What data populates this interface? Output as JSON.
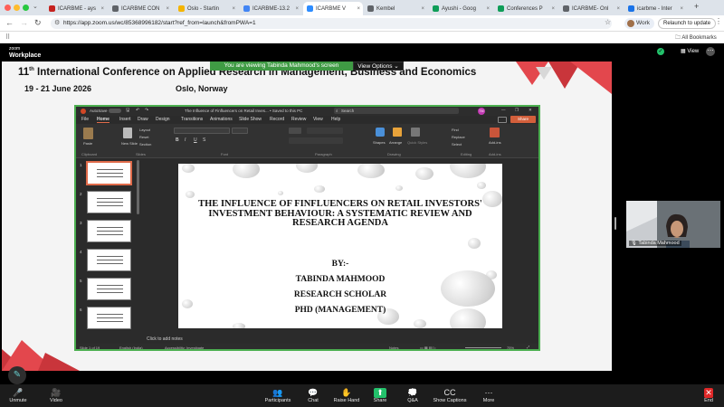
{
  "browser": {
    "tabs": [
      {
        "title": "ICARBME - ays",
        "color": "#c5221f"
      },
      {
        "title": "ICARBME CON",
        "color": "#5f6368"
      },
      {
        "title": "Oslo - Startin",
        "color": "#f4b400"
      },
      {
        "title": "ICARBME-13.2",
        "color": "#4285f4"
      },
      {
        "title": "ICARBME V",
        "color": "#2d8cff",
        "active": true
      },
      {
        "title": "Kembel",
        "color": "#5f6368"
      },
      {
        "title": "Ayushi - Goog",
        "color": "#0f9d58"
      },
      {
        "title": "Conferences P",
        "color": "#0f9d58"
      },
      {
        "title": "ICARBME- Onl",
        "color": "#5f6368"
      },
      {
        "title": "icarbme - Inter",
        "color": "#1a73e8"
      }
    ],
    "url": "https://app.zoom.us/wc/85368996182/start?ref_from=launch&fromPWA=1",
    "work_label": "Work",
    "relaunch_label": "Relaunch to update",
    "bookmarks_label": "All Bookmarks"
  },
  "zoom": {
    "brand_line1": "zoom",
    "brand_line2": "Workplace",
    "viewing_banner": "You are viewing  Tabinda Mahmood's screen",
    "view_options": "View Options",
    "view_label": "View",
    "participant_name": "Tabinda Mahmood",
    "toolbar": [
      {
        "label": "Unmute",
        "icon": "🎤"
      },
      {
        "label": "Video",
        "icon": "🎥"
      },
      {
        "label": "Participants",
        "icon": "👥"
      },
      {
        "label": "Chat",
        "icon": "💬"
      },
      {
        "label": "Raise Hand",
        "icon": "✋"
      },
      {
        "label": "Share",
        "icon": "⬆"
      },
      {
        "label": "Q&A",
        "icon": "💭"
      },
      {
        "label": "Show Captions",
        "icon": "CC"
      },
      {
        "label": "More",
        "icon": "⋯"
      },
      {
        "label": "End",
        "icon": "✕"
      }
    ]
  },
  "conference": {
    "title_prefix": "11",
    "title_sup": "th",
    "title_rest": " International Conference on Applied Research in Management, Business and Economics",
    "dates": "19 - 21 June 2026",
    "place": "Oslo, Norway"
  },
  "powerpoint": {
    "window_title": "The Influence of Finfluencers on Retail Inves...  •  Saved to this PC",
    "search": "Search",
    "autosave": "AutoSave",
    "avatar": "TM",
    "menu": [
      "File",
      "Home",
      "Insert",
      "Draw",
      "Design",
      "Transitions",
      "Animations",
      "Slide Show",
      "Record",
      "Review",
      "View",
      "Help"
    ],
    "share_label": "Share",
    "ribbon_groups": [
      "Clipboard",
      "Slides",
      "Font",
      "Paragraph",
      "Drawing",
      "Editing",
      "Add-ins"
    ],
    "ribbon_buttons": {
      "paste": "Paste",
      "new_slide": "New Slide",
      "layout": "Layout",
      "reset": "Reset",
      "section": "Section",
      "shapes": "Shapes",
      "arrange": "Arrange",
      "quick_styles": "Quick Styles",
      "find": "Find",
      "replace": "Replace",
      "select": "Select",
      "addins": "Add-ins"
    },
    "slide_numbers": [
      "1",
      "2",
      "3",
      "4",
      "5",
      "6"
    ],
    "slide": {
      "title": "THE INFLUENCE OF FINFLUENCERS ON RETAIL INVESTORS' INVESTMENT BEHAVIOUR: A SYSTEMATIC REVIEW AND RESEARCH AGENDA",
      "by": "BY:-",
      "author": "TABINDA MAHMOOD",
      "role": "RESEARCH SCHOLAR",
      "degree": "PHD (MANAGEMENT)"
    },
    "notes_placeholder": "Click to add notes",
    "status": {
      "slide": "Slide 1 of 19",
      "language": "English (India)",
      "accessibility": "Accessibility: Investigate",
      "notes": "Notes",
      "zoom": "75%"
    }
  }
}
